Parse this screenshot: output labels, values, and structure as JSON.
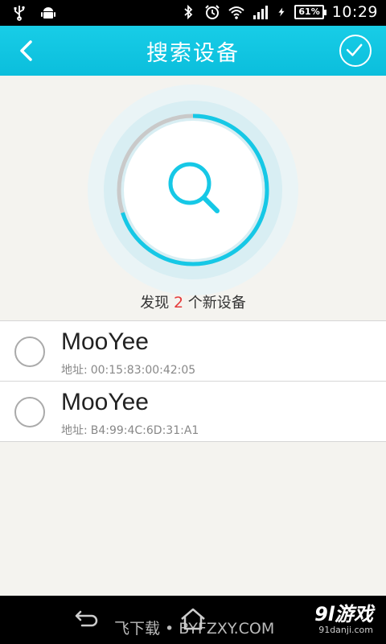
{
  "status_bar": {
    "time": "10:29",
    "battery": "61%",
    "icons": [
      "usb-icon",
      "android-icon",
      "bluetooth-icon",
      "alarm-icon",
      "wifi-icon",
      "signal-icon",
      "charging-icon"
    ]
  },
  "header": {
    "title": "搜索设备",
    "back_icon": "chevron-left-icon",
    "confirm_icon": "check-circle-icon"
  },
  "scan": {
    "icon": "search-icon",
    "progress": 0.7,
    "accent_color": "#16c8e6",
    "prefix": "发现",
    "count": "2",
    "suffix": "个新设备"
  },
  "devices": [
    {
      "name": "MooYee",
      "address_label": "地址:",
      "address": "00:15:83:00:42:05",
      "selected": false
    },
    {
      "name": "MooYee",
      "address_label": "地址:",
      "address": "B4:99:4C:6D:31:A1",
      "selected": false
    }
  ],
  "nav_bar": {
    "watermark_left": "飞下载 • BYFZXY.COM",
    "watermark_right_big": "9l游戏",
    "watermark_right_small": "91danji.com"
  }
}
